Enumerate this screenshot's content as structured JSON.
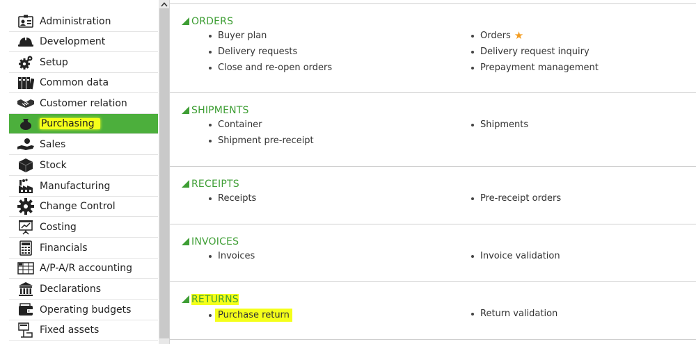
{
  "sidebar": {
    "items": [
      {
        "label": "Administration",
        "icon": "id-card-icon"
      },
      {
        "label": "Development",
        "icon": "helmet-icon"
      },
      {
        "label": "Setup",
        "icon": "gear-icon"
      },
      {
        "label": "Common data",
        "icon": "binders-icon"
      },
      {
        "label": "Customer relation",
        "icon": "handshake-icon"
      },
      {
        "label": "Purchasing",
        "icon": "money-bag-icon",
        "active": true
      },
      {
        "label": "Sales",
        "icon": "hand-coin-icon"
      },
      {
        "label": "Stock",
        "icon": "box-icon"
      },
      {
        "label": "Manufacturing",
        "icon": "factory-icon"
      },
      {
        "label": "Change Control",
        "icon": "cog-large-icon"
      },
      {
        "label": "Costing",
        "icon": "presentation-chart-icon"
      },
      {
        "label": "Financials",
        "icon": "calculator-icon"
      },
      {
        "label": "A/P-A/R accounting",
        "icon": "ledger-icon"
      },
      {
        "label": "Declarations",
        "icon": "government-building-icon"
      },
      {
        "label": "Operating budgets",
        "icon": "wallet-icon"
      },
      {
        "label": "Fixed assets",
        "icon": "asset-tag-icon"
      }
    ]
  },
  "sections": {
    "orders": {
      "title": "ORDERS",
      "left": [
        "Buyer plan",
        "Delivery requests",
        "Close and re-open orders"
      ],
      "right": [
        "Orders",
        "Delivery request inquiry",
        "Prepayment management"
      ]
    },
    "shipments": {
      "title": "SHIPMENTS",
      "left": [
        "Container",
        "Shipment pre-receipt"
      ],
      "right": [
        "Shipments"
      ]
    },
    "receipts": {
      "title": "RECEIPTS",
      "left": [
        "Receipts"
      ],
      "right": [
        "Pre-receipt orders"
      ]
    },
    "invoices": {
      "title": "INVOICES",
      "left": [
        "Invoices"
      ],
      "right": [
        "Invoice validation"
      ]
    },
    "returns": {
      "title": "RETURNS",
      "left": [
        "Purchase return"
      ],
      "right": [
        "Return validation"
      ]
    }
  },
  "colors": {
    "accent_green": "#3e9e34",
    "active_item_bg": "#4caf3c",
    "highlight_yellow": "#f4ff1a",
    "favorite_star": "#f39c20"
  }
}
